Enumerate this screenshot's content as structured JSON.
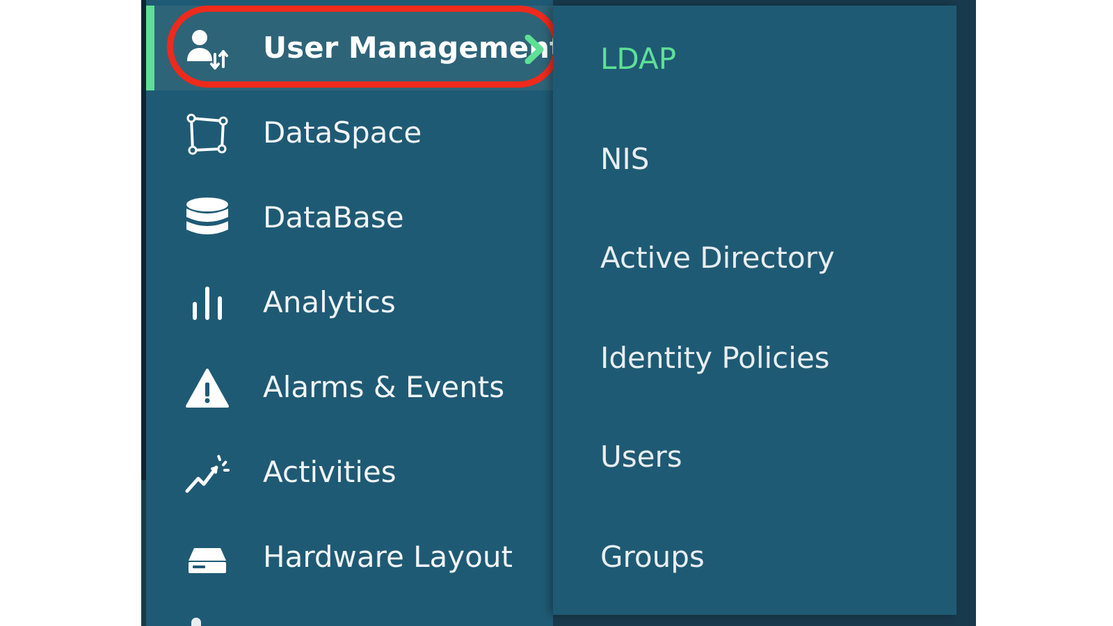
{
  "sidebar": {
    "items": [
      {
        "label": "User Management",
        "icon": "user-management-icon",
        "active": true
      },
      {
        "label": "DataSpace",
        "icon": "dataspace-icon",
        "active": false
      },
      {
        "label": "DataBase",
        "icon": "database-icon",
        "active": false
      },
      {
        "label": "Analytics",
        "icon": "analytics-icon",
        "active": false
      },
      {
        "label": "Alarms & Events",
        "icon": "warning-icon",
        "active": false
      },
      {
        "label": "Activities",
        "icon": "activity-icon",
        "active": false
      },
      {
        "label": "Hardware Layout",
        "icon": "hardware-icon",
        "active": false
      }
    ]
  },
  "submenu": {
    "items": [
      {
        "label": "LDAP",
        "selected": true
      },
      {
        "label": "NIS",
        "selected": false
      },
      {
        "label": "Active Directory",
        "selected": false
      },
      {
        "label": "Identity Policies",
        "selected": false
      },
      {
        "label": "Users",
        "selected": false
      },
      {
        "label": "Groups",
        "selected": false
      }
    ]
  },
  "colors": {
    "sidebar_bg": "#1f5a74",
    "active_item_bg": "#2e6478",
    "accent_green": "#5ee095",
    "highlight_ring": "#ee2a1c",
    "text": "#f2f5f7"
  }
}
